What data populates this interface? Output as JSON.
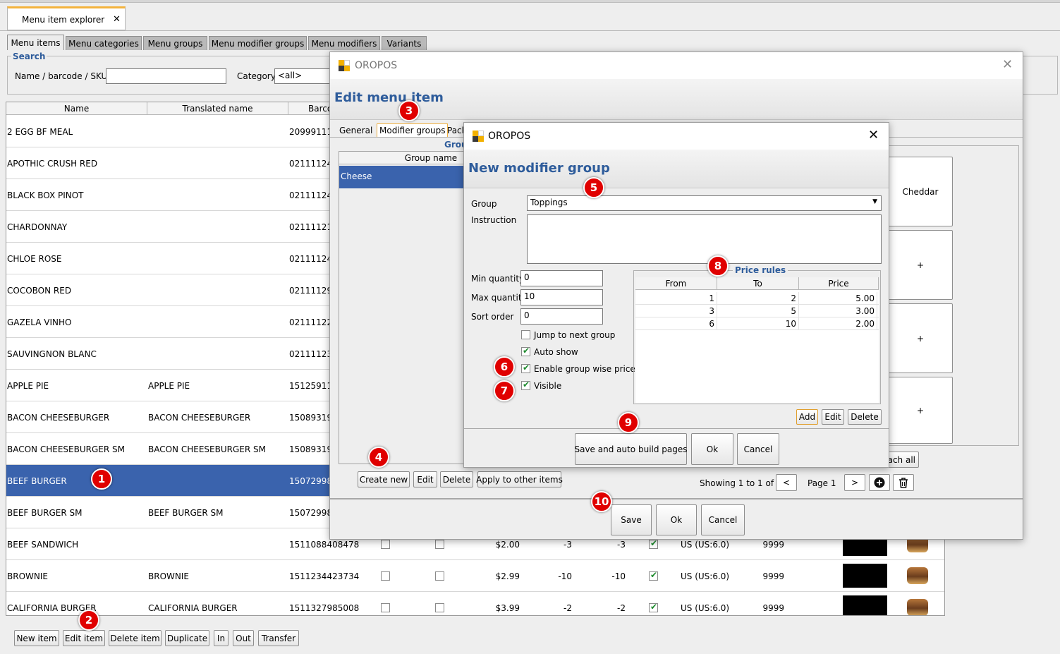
{
  "main_tab": {
    "label": "Menu item explorer",
    "close": "✕"
  },
  "sub_tabs": [
    "Menu items",
    "Menu categories",
    "Menu groups",
    "Menu modifier groups",
    "Menu modifiers",
    "Variants"
  ],
  "search": {
    "legend": "Search",
    "name_label": "Name / barcode / SKU:",
    "name_value": "",
    "category_label": "Category",
    "category_value": "<all>"
  },
  "table": {
    "headers": [
      "Name",
      "Translated name",
      "Barco"
    ],
    "rows": [
      {
        "name": "2 EGG BF MEAL",
        "translated": "",
        "barcode": "20999111"
      },
      {
        "name": "APOTHIC CRUSH RED",
        "translated": "",
        "barcode": "02111124"
      },
      {
        "name": "BLACK BOX PINOT",
        "translated": "",
        "barcode": "02111124"
      },
      {
        "name": "CHARDONNAY",
        "translated": "",
        "barcode": "02111121"
      },
      {
        "name": "CHLOE ROSE",
        "translated": "",
        "barcode": "02111124"
      },
      {
        "name": "COCOBON RED",
        "translated": "",
        "barcode": "02111129"
      },
      {
        "name": "GAZELA VINHO",
        "translated": "",
        "barcode": "02111122"
      },
      {
        "name": "SAUVINGNON BLANC",
        "translated": "",
        "barcode": "02111123"
      },
      {
        "name": "APPLE PIE",
        "translated": "APPLE PIE",
        "barcode": "15125911"
      },
      {
        "name": "BACON CHEESEBURGER",
        "translated": "BACON CHEESEBURGER",
        "barcode": "15089319"
      },
      {
        "name": "BACON CHEESEBURGER SM",
        "translated": "BACON CHEESEBURGER SM",
        "barcode": "15089319"
      },
      {
        "name": "BEEF BURGER",
        "translated": "",
        "barcode": "15072998"
      },
      {
        "name": "BEEF BURGER SM",
        "translated": "BEEF BURGER SM",
        "barcode": "15072998"
      },
      {
        "name": "BEEF SANDWICH",
        "translated": "",
        "barcode": "1511088408478",
        "price": "$2.00",
        "q1": "-3",
        "q2": "-3",
        "tax": "US (US:6.0)",
        "num": "9999"
      },
      {
        "name": "BROWNIE",
        "translated": "BROWNIE",
        "barcode": "1511234423734",
        "price": "$2.99",
        "q1": "-10",
        "q2": "-10",
        "tax": "US (US:6.0)",
        "num": "9999"
      },
      {
        "name": "CALIFORNIA BURGER",
        "translated": "CALIFORNIA BURGER",
        "barcode": "1511327985008",
        "price": "$3.99",
        "q1": "-2",
        "q2": "-2",
        "tax": "US (US:6.0)",
        "num": "9999"
      }
    ]
  },
  "bottom_buttons": [
    "New item",
    "Edit item",
    "Delete item",
    "Duplicate",
    "In",
    "Out",
    "Transfer"
  ],
  "edit_dialog": {
    "app_name": "OROPOS",
    "title": "Edit menu item",
    "tabs": [
      "General",
      "Modifier groups",
      "Pack"
    ],
    "group_cut_label": "Grou",
    "group_table_header": "Group name",
    "group_rows": [
      "Cheese"
    ],
    "right_buttons": [
      "Cheddar",
      "+",
      "+",
      "+"
    ],
    "each_all": "ach all",
    "action_buttons": [
      "Create new",
      "Edit",
      "Delete",
      "Apply to other items"
    ],
    "paging": {
      "showing": "Showing 1 to 1 of 1",
      "page": "Page 1",
      "prev": "<",
      "next": ">"
    },
    "footer_buttons": [
      "Save",
      "Ok",
      "Cancel"
    ]
  },
  "modifier_dialog": {
    "app_name": "OROPOS",
    "title": "New modifier group",
    "group_label": "Group",
    "group_value": "Toppings",
    "instruction_label": "Instruction",
    "instruction_value": "",
    "min_label": "Min quantity",
    "min_value": "0",
    "max_label": "Max quantity",
    "max_value": "10",
    "sort_label": "Sort order",
    "sort_value": "0",
    "checks": [
      {
        "label": "Jump to next group",
        "checked": false
      },
      {
        "label": "Auto show",
        "checked": true
      },
      {
        "label": "Enable group wise price",
        "checked": true
      },
      {
        "label": "Visible",
        "checked": true
      }
    ],
    "price_rules": {
      "legend": "Price rules",
      "headers": [
        "From",
        "To",
        "Price"
      ],
      "rows": [
        [
          "1",
          "2",
          "5.00"
        ],
        [
          "3",
          "5",
          "3.00"
        ],
        [
          "6",
          "10",
          "2.00"
        ]
      ],
      "buttons": [
        "Add",
        "Edit",
        "Delete"
      ]
    },
    "footer_buttons": [
      "Save and auto build pages",
      "Ok",
      "Cancel"
    ]
  },
  "badges": [
    "1",
    "2",
    "3",
    "4",
    "5",
    "6",
    "7",
    "8",
    "9",
    "10"
  ],
  "colors": {
    "selection": "#3a63ad",
    "title_blue": "#2e5c9b",
    "badge_red": "#e00000"
  }
}
